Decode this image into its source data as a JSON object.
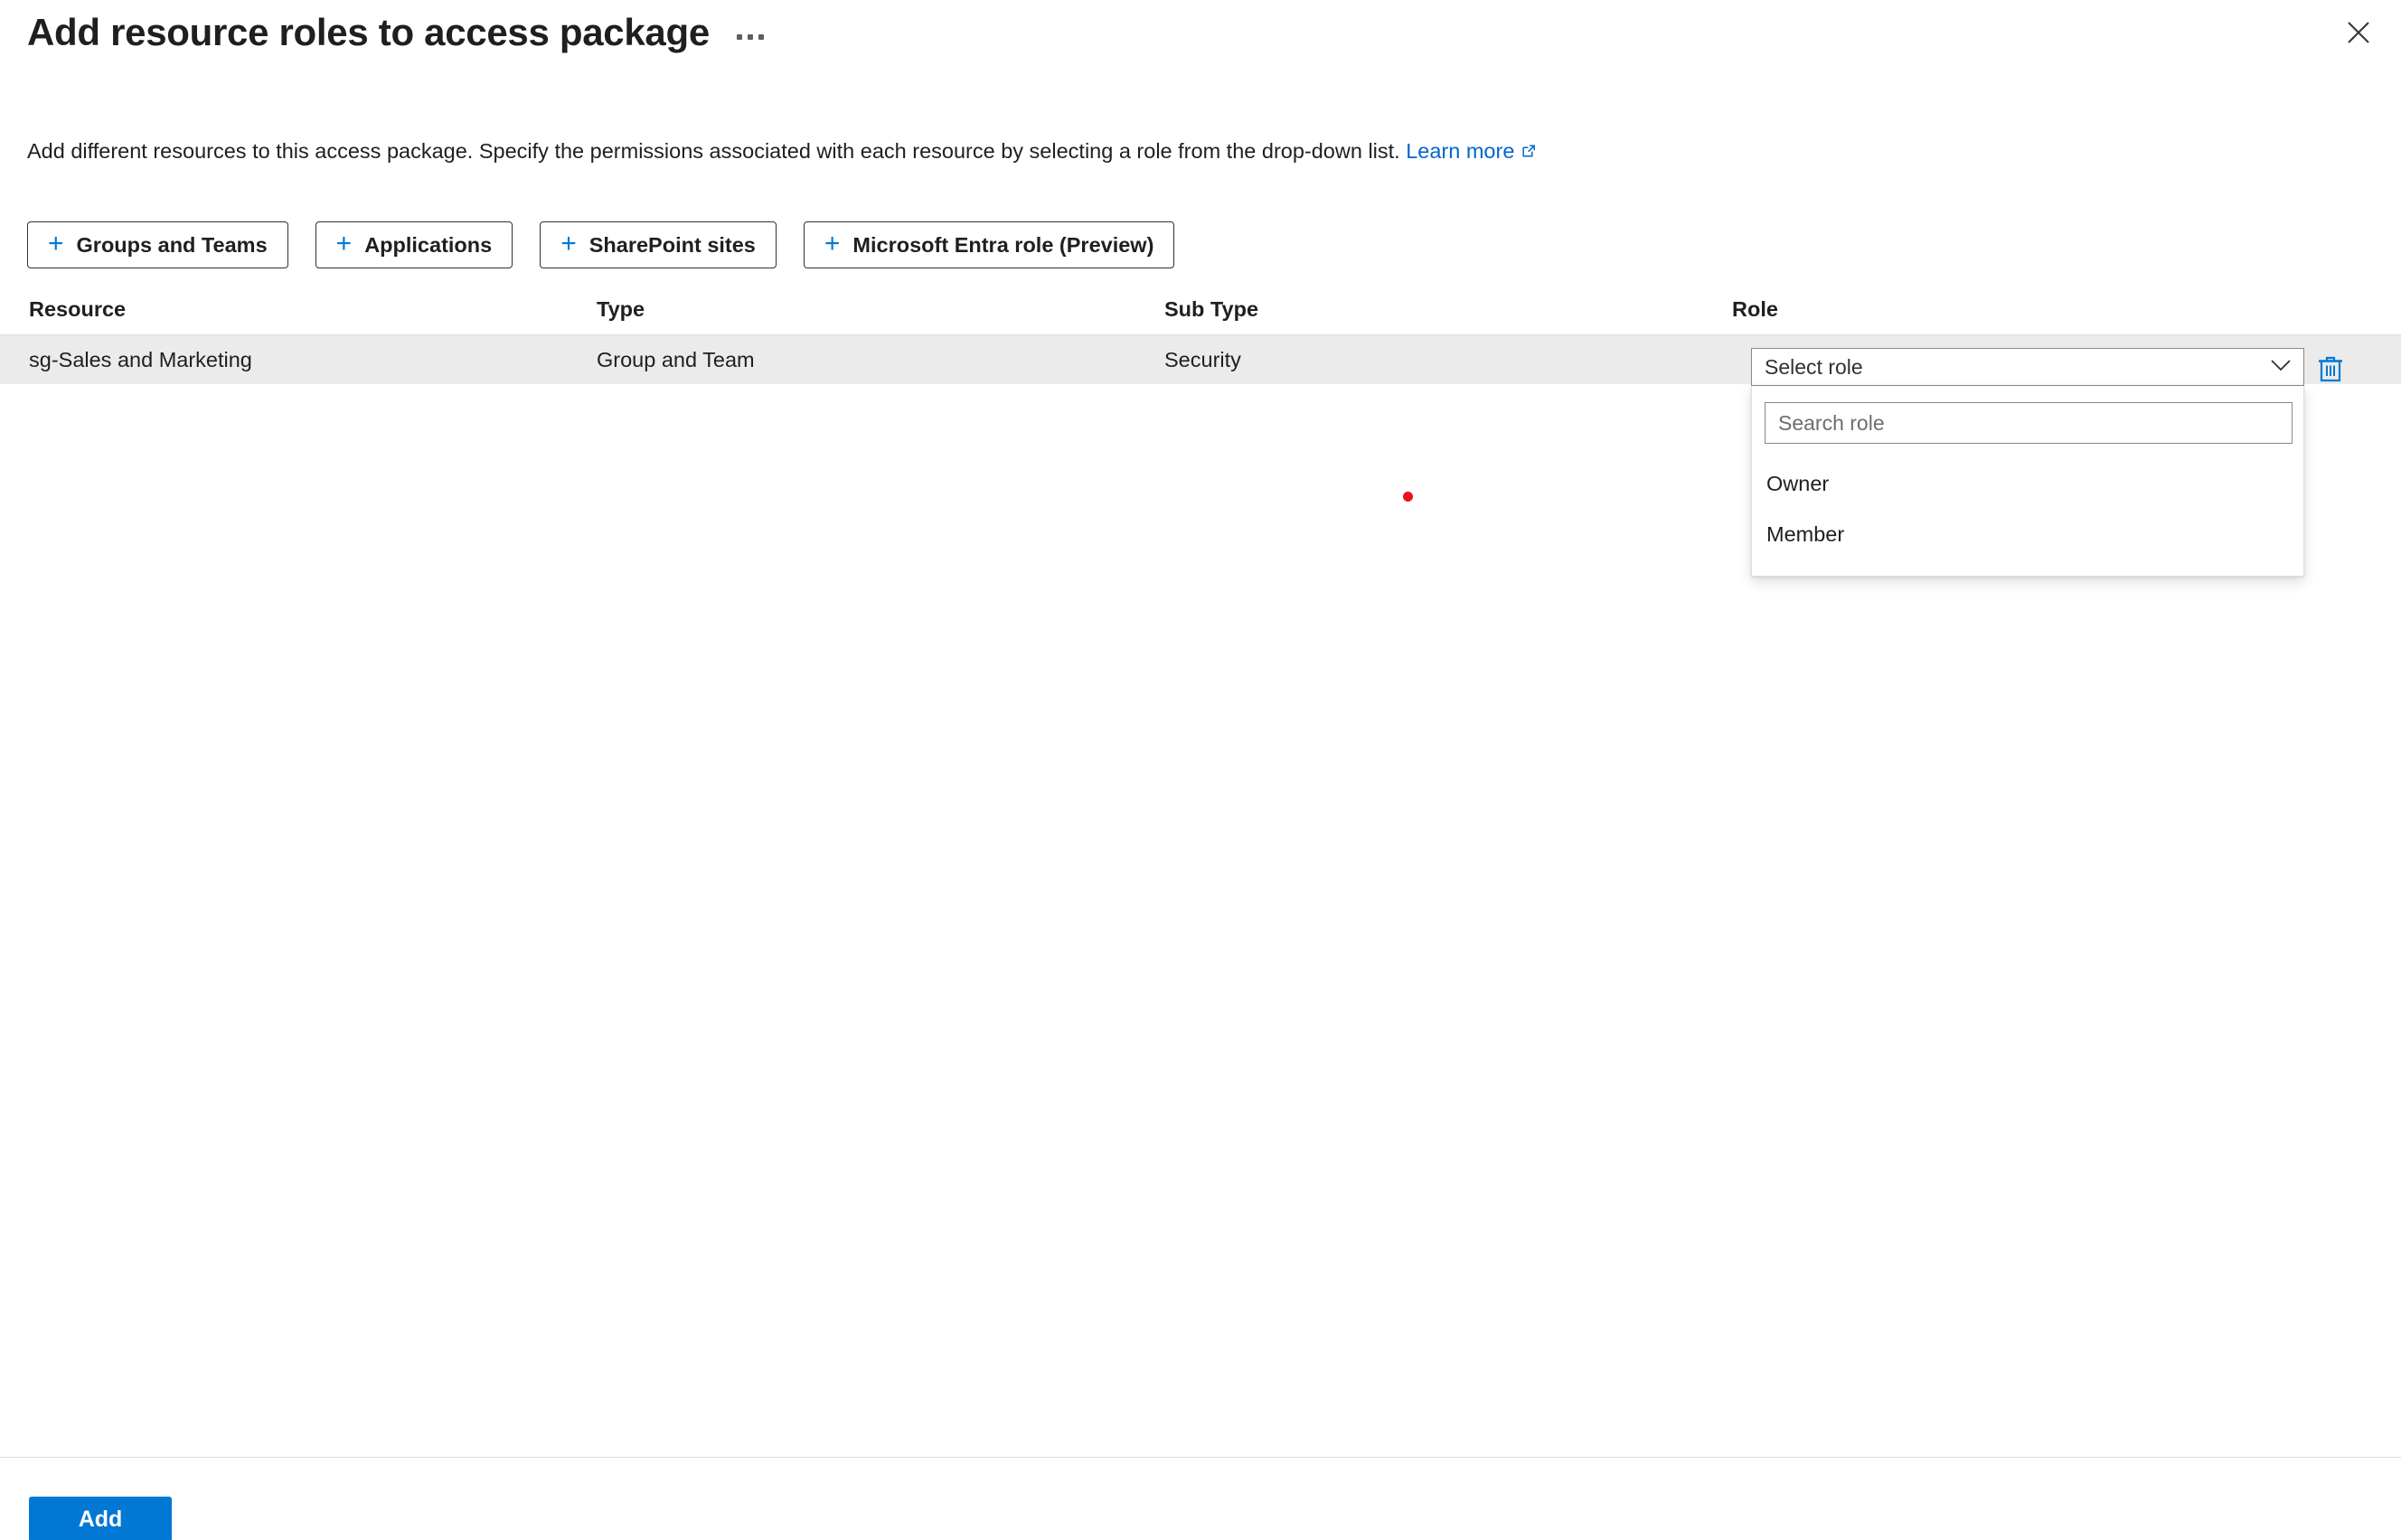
{
  "header": {
    "title": "Add resource roles to access package",
    "more_menu": "…",
    "close_label": "Close"
  },
  "description": {
    "text": "Add different resources to this access package. Specify the permissions associated with each resource by selecting a role from the drop-down list.",
    "link_label": "Learn more"
  },
  "command_bar": {
    "buttons": [
      {
        "label": "Groups and Teams",
        "icon": "plus-icon"
      },
      {
        "label": "Applications",
        "icon": "plus-icon"
      },
      {
        "label": "SharePoint sites",
        "icon": "plus-icon"
      },
      {
        "label": "Microsoft Entra role (Preview)",
        "icon": "plus-icon"
      }
    ]
  },
  "table": {
    "columns": [
      "Resource",
      "Type",
      "Sub Type",
      "Role"
    ],
    "rows": [
      {
        "resource": "sg-Sales and Marketing",
        "type": "Group and Team",
        "sub_type": "Security",
        "role_value": "",
        "role_placeholder": "Select role"
      }
    ]
  },
  "role_dropdown": {
    "selected_text": "Select role",
    "search_placeholder": "Search role",
    "search_value": "",
    "options": [
      "Owner",
      "Member"
    ],
    "expanded": true
  },
  "footer": {
    "add_label": "Add"
  },
  "colors": {
    "accent": "#0078d4",
    "link": "#0066cc",
    "row_background": "#ebebeb",
    "border": "#e1dfdd",
    "cursor_marker": "#e81123"
  }
}
